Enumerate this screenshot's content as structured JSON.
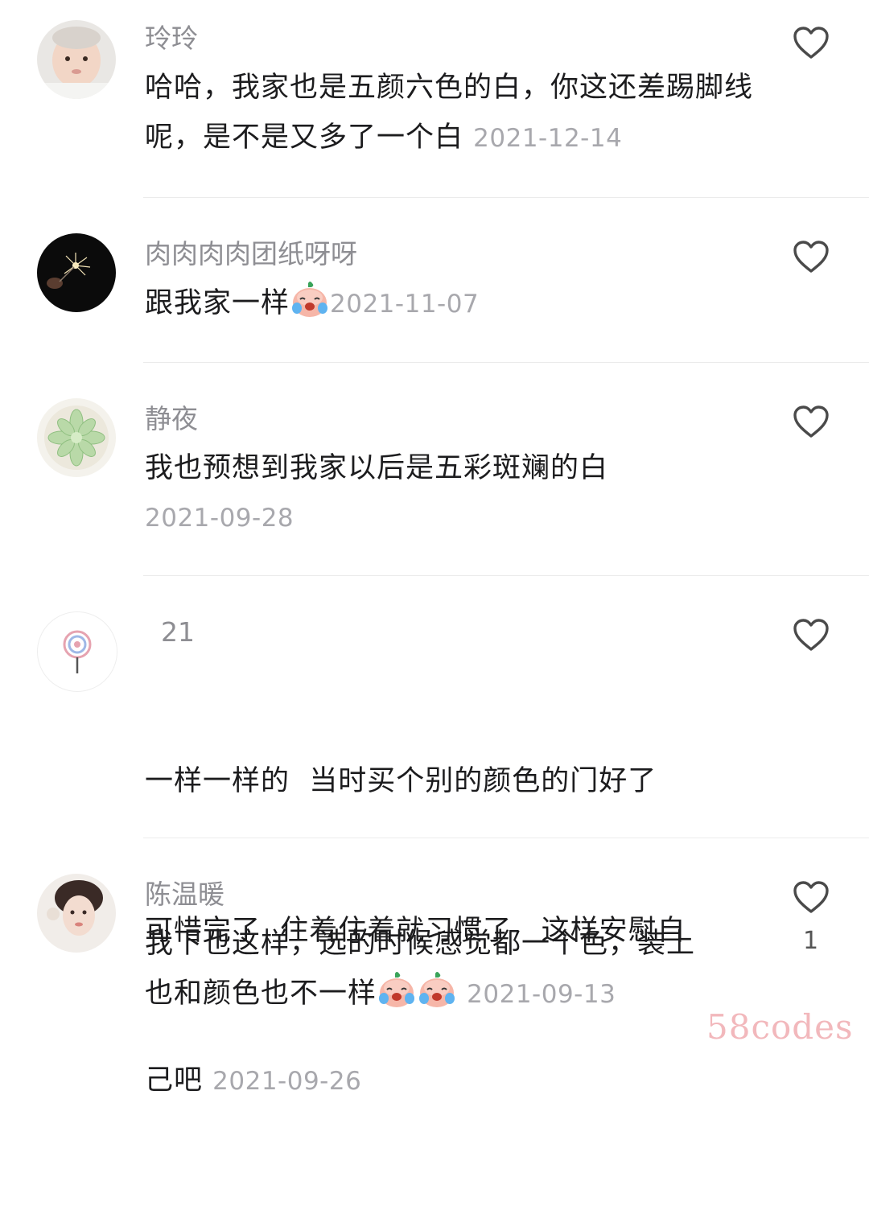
{
  "comments": [
    {
      "username": "玲玲",
      "text": "哈哈，我家也是五颜六色的白，你这还差踢脚线呢，是不是又多了一个白",
      "time": "2021-12-14",
      "avatar_icon": "baby-photo-avatar"
    },
    {
      "username": "肉肉肉肉团纸呀呀",
      "text": "跟我家一样",
      "emoji": "crying-face-emoji",
      "time": "2021-11-07",
      "avatar_icon": "sparkler-photo-avatar"
    },
    {
      "username": "静夜",
      "text": "我也预想到我家以后是五彩斑斓的白",
      "time": "2021-09-28",
      "avatar_icon": "succulent-photo-avatar"
    },
    {
      "username": "21",
      "line1": "一样一样的  当时买个别的颜色的门好了",
      "line2": "可惜完了  住着住着就习惯了   这样安慰自",
      "line3": "己吧",
      "time": "2021-09-26",
      "avatar_icon": "lollipop-avatar"
    },
    {
      "username": "陈温暖",
      "line1": "我下也这样，选的时候感觉都一个色，装上",
      "line2": "也和颜色也不一样",
      "emoji": "crying-face-emoji",
      "time": "2021-09-13",
      "likes": "1",
      "avatar_icon": "woman-photo-avatar"
    }
  ],
  "watermark": "58codes",
  "colors": {
    "username": "#8e8e93",
    "text": "#1c1c1e",
    "timestamp": "#a8a8ad",
    "watermark": "#f2b8bc"
  }
}
